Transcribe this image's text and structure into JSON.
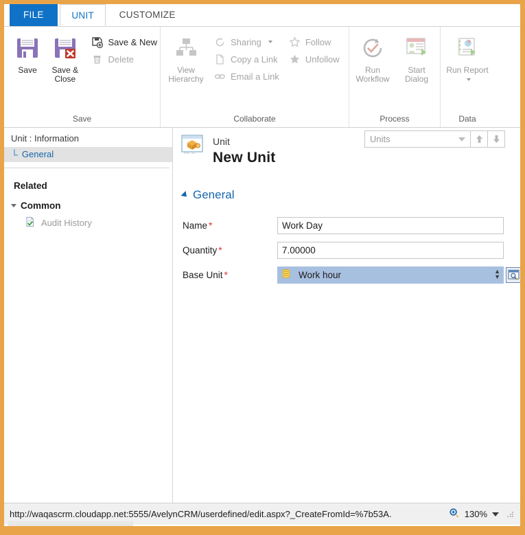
{
  "window": {
    "border_color": "#e9a44a"
  },
  "ribbon": {
    "tabs": [
      {
        "label": "FILE",
        "state": "file"
      },
      {
        "label": "UNIT",
        "state": "active"
      },
      {
        "label": "CUSTOMIZE",
        "state": "plain"
      }
    ],
    "groups": [
      {
        "title": "Save",
        "big_buttons": [
          {
            "label": "Save",
            "icon": "save-floppy-icon",
            "enabled": true
          },
          {
            "label": "Save & Close",
            "icon": "save-close-floppy-icon",
            "enabled": true
          }
        ],
        "small_buttons": [
          {
            "label": "Save & New",
            "icon": "save-new-icon",
            "enabled": true
          },
          {
            "label": "Delete",
            "icon": "trash-icon",
            "enabled": false
          }
        ]
      },
      {
        "title": "Collaborate",
        "big_buttons": [
          {
            "label": "View Hierarchy",
            "icon": "hierarchy-icon",
            "enabled": false
          }
        ],
        "small_buttons": [
          {
            "label": "Sharing",
            "icon": "share-icon",
            "enabled": false,
            "has_caret": true
          },
          {
            "label": "Copy a Link",
            "icon": "page-icon",
            "enabled": false
          },
          {
            "label": "Email a Link",
            "icon": "link-icon",
            "enabled": false
          },
          {
            "label": "Follow",
            "icon": "star-outline-icon",
            "enabled": false
          },
          {
            "label": "Unfollow",
            "icon": "star-filled-icon",
            "enabled": false
          }
        ]
      },
      {
        "title": "Process",
        "big_buttons": [
          {
            "label": "Run Workflow",
            "icon": "workflow-icon",
            "enabled": false
          },
          {
            "label": "Start Dialog",
            "icon": "dialog-icon",
            "enabled": false
          }
        ],
        "small_buttons": []
      },
      {
        "title": "Data",
        "big_buttons": [
          {
            "label": "Run Report",
            "icon": "report-icon",
            "enabled": false,
            "has_caret": true
          }
        ],
        "small_buttons": []
      }
    ],
    "labels": {
      "save": "Save",
      "save_close": "Save & Close",
      "save_new": "Save & New",
      "delete": "Delete",
      "view_hierarchy": "View Hierarchy",
      "sharing": "Sharing",
      "copy_link": "Copy a Link",
      "email_link": "Email a Link",
      "follow": "Follow",
      "unfollow": "Unfollow",
      "run_workflow": "Run Workflow",
      "start_dialog": "Start Dialog",
      "run_report": "Run Report",
      "group_save": "Save",
      "group_collaborate": "Collaborate",
      "group_process": "Process",
      "group_data": "Data"
    }
  },
  "navpane": {
    "title": "Unit : Information",
    "selected_item": "General",
    "related_header": "Related",
    "common_header": "Common",
    "common_items": [
      {
        "label": "Audit History",
        "icon": "audit-history-icon"
      }
    ]
  },
  "form": {
    "entity_label": "Unit",
    "record_title": "New Unit",
    "entity_icon": "unit-box-icon",
    "lookup_select_value": "Units",
    "section_title": "General",
    "fields": [
      {
        "label": "Name",
        "required": true,
        "value": "Work Day",
        "type": "text"
      },
      {
        "label": "Quantity",
        "required": true,
        "value": "7.00000",
        "type": "text"
      },
      {
        "label": "Base Unit",
        "required": true,
        "value": "Work hour",
        "type": "lookup",
        "selected": true,
        "icon": "unit-stack-icon"
      }
    ],
    "required_marker": "*"
  },
  "statusbar": {
    "url": "http://waqascrm.cloudapp.net:5555/AvelynCRM/userdefined/edit.aspx?_CreateFromId=%7b53A.",
    "zoom_level": "130%",
    "zoom_icon": "magnifier-plus-icon"
  }
}
